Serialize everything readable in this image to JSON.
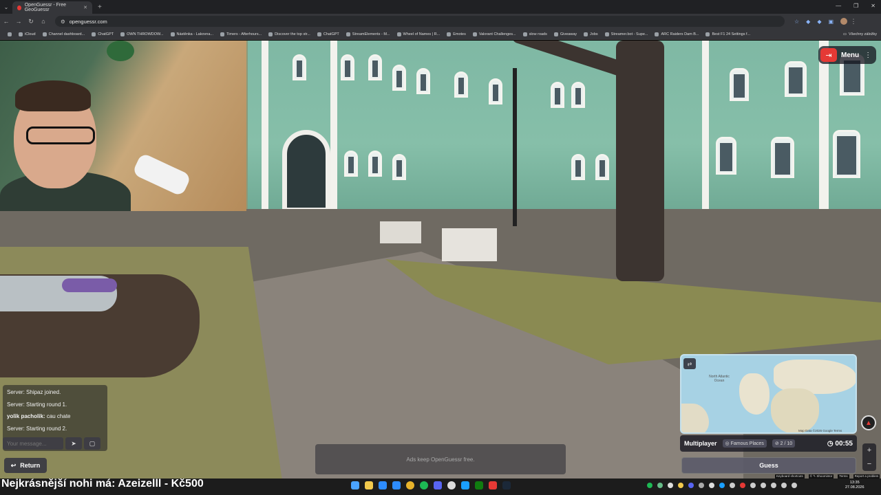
{
  "browser": {
    "tab_title": "OpenGuessr - Free GeoGuessr",
    "url": "openguessr.com",
    "bookmarks": [
      "iCloud",
      "Channel dashboard...",
      "ChatGPT",
      "OWN THROWDOW...",
      "Nástěnka - Lakovna...",
      "Timers - Afterhours...",
      "Discover the top str...",
      "ChatGPT",
      "StreamElements - M...",
      "Wheel of Names | R...",
      "Emotes",
      "Valorant Challenges...",
      "slow roads",
      "Giveaway",
      "Jobs",
      "Streamer.bot - Supe...",
      "ARC Raiders Dam B...",
      "Best F1 24 Settings f..."
    ],
    "bookmarks_more": "Všechny záložky"
  },
  "game": {
    "menu_label": "Menu",
    "chat_lines": [
      {
        "user": "Server:",
        "text": "Shipaz joined."
      },
      {
        "user": "Server:",
        "text": "Starting round 1."
      },
      {
        "user": "yolik pacholik:",
        "text": "cau chate"
      },
      {
        "user": "Server:",
        "text": "Starting round 2."
      }
    ],
    "chat_placeholder": "Your message...",
    "return_label": "Return",
    "ads_text": "Ads keep OpenGuessr free.",
    "map_labels": {
      "ocean": "North Atlantic Ocean",
      "attribution": "Map Data ©2026 Google  Terms"
    },
    "mode": "Multiplayer",
    "map_name": "Famous Places",
    "round": "2 / 10",
    "timer": "00:55",
    "guess_label": "Guess",
    "map_footer": [
      "Keyboard shortcuts",
      "© ✎ Shoomintor",
      "Terms",
      "Report a problem"
    ]
  },
  "stream": {
    "overlay_text": "Nejkrásnější nohi má: Azeizelll - Kč500"
  },
  "system": {
    "time": "13:35",
    "date": "27.08.2026"
  }
}
